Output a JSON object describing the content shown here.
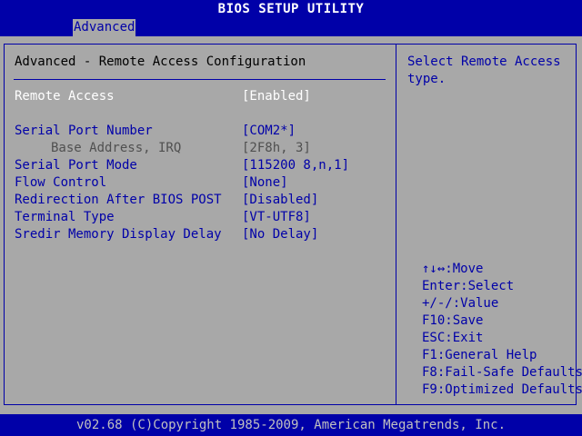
{
  "title": "BIOS SETUP UTILITY",
  "menu": {
    "active_tab": "Advanced"
  },
  "section_title": "Advanced - Remote Access Configuration",
  "settings": [
    {
      "label": "Remote Access",
      "value": "[Enabled]"
    },
    {
      "label": "Serial Port Number",
      "value": "[COM2*]"
    },
    {
      "label": "Base Address, IRQ",
      "value": "[2F8h, 3]"
    },
    {
      "label": "Serial Port Mode",
      "value": "[115200 8,n,1]"
    },
    {
      "label": "Flow Control",
      "value": "[None]"
    },
    {
      "label": "Redirection After BIOS POST",
      "value": "[Disabled]"
    },
    {
      "label": "Terminal Type",
      "value": "[VT-UTF8]"
    },
    {
      "label": "Sredir Memory Display Delay",
      "value": "[No Delay]"
    }
  ],
  "help": {
    "text": "Select Remote Access type."
  },
  "keys": [
    "↑↓↔:Move",
    "Enter:Select",
    "+/-/:Value",
    "F10:Save",
    "ESC:Exit",
    "F1:General Help",
    "F8:Fail-Safe Defaults",
    "F9:Optimized Defaults"
  ],
  "footer": "v02.68 (C)Copyright 1985-2009, American Megatrends, Inc.",
  "colors": {
    "background_blue": "#0000a8",
    "panel_gray": "#a8a8a8",
    "selected_text": "#ffffff",
    "disabled_text": "#505050"
  }
}
